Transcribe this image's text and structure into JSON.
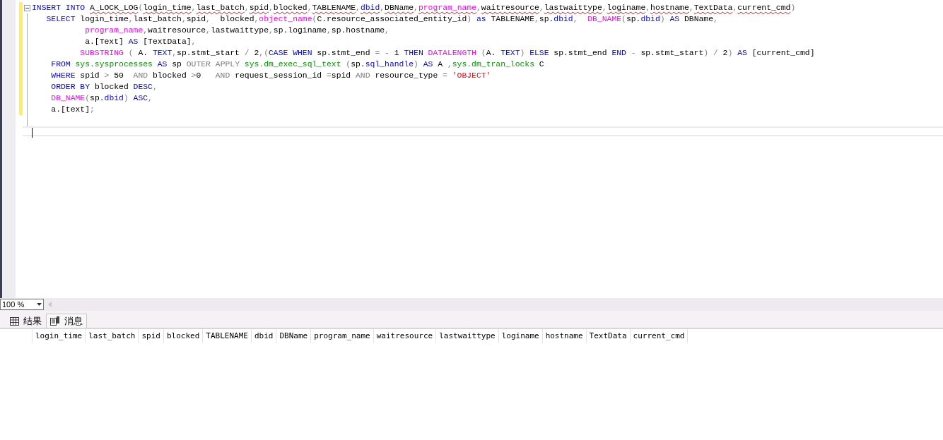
{
  "editor": {
    "lines": [
      {
        "collapsible": true,
        "tokens": [
          {
            "text": "INSERT INTO ",
            "kind": "keyword"
          },
          {
            "text": "A_LOCK_LOG",
            "kind": "plain-flagged"
          },
          {
            "text": "(",
            "kind": "operator"
          },
          {
            "text": "login_time",
            "kind": "plain-flagged"
          },
          {
            "text": ",",
            "kind": "operator"
          },
          {
            "text": "last_batch",
            "kind": "plain-flagged"
          },
          {
            "text": ",",
            "kind": "operator"
          },
          {
            "text": "spid",
            "kind": "plain-flagged"
          },
          {
            "text": ",",
            "kind": "operator"
          },
          {
            "text": "blocked",
            "kind": "plain-flagged"
          },
          {
            "text": ",",
            "kind": "operator"
          },
          {
            "text": "TABLENAME",
            "kind": "plain-flagged"
          },
          {
            "text": ",",
            "kind": "operator"
          },
          {
            "text": "dbid",
            "kind": "keyword-flagged"
          },
          {
            "text": ",",
            "kind": "operator"
          },
          {
            "text": "DBName",
            "kind": "plain-flagged"
          },
          {
            "text": ",",
            "kind": "operator"
          },
          {
            "text": "program_name",
            "kind": "function-flagged"
          },
          {
            "text": ",",
            "kind": "operator"
          },
          {
            "text": "waitresource",
            "kind": "plain-flagged"
          },
          {
            "text": ",",
            "kind": "operator"
          },
          {
            "text": "lastwaittype",
            "kind": "plain-flagged"
          },
          {
            "text": ",",
            "kind": "operator"
          },
          {
            "text": "loginame",
            "kind": "plain-flagged"
          },
          {
            "text": ",",
            "kind": "operator"
          },
          {
            "text": "hostname",
            "kind": "plain-flagged"
          },
          {
            "text": ",",
            "kind": "operator"
          },
          {
            "text": "TextData",
            "kind": "plain-flagged"
          },
          {
            "text": ",",
            "kind": "operator"
          },
          {
            "text": "current_cmd",
            "kind": "plain-flagged"
          },
          {
            "text": ")",
            "kind": "operator"
          }
        ]
      },
      {
        "collapsible": false,
        "tokens": [
          {
            "text": "   SELECT ",
            "kind": "keyword"
          },
          {
            "text": "login_time",
            "kind": "plain"
          },
          {
            "text": ",",
            "kind": "operator"
          },
          {
            "text": "last_batch",
            "kind": "plain"
          },
          {
            "text": ",",
            "kind": "operator"
          },
          {
            "text": "spid",
            "kind": "plain"
          },
          {
            "text": ",",
            "kind": "operator"
          },
          {
            "text": "  blocked",
            "kind": "plain"
          },
          {
            "text": ",",
            "kind": "operator"
          },
          {
            "text": "object_name",
            "kind": "function"
          },
          {
            "text": "(",
            "kind": "operator"
          },
          {
            "text": "C.resource_associated_entity_id",
            "kind": "plain"
          },
          {
            "text": ") ",
            "kind": "operator"
          },
          {
            "text": "as ",
            "kind": "keyword"
          },
          {
            "text": "TABLENAME",
            "kind": "plain"
          },
          {
            "text": ",",
            "kind": "operator"
          },
          {
            "text": "sp.",
            "kind": "plain"
          },
          {
            "text": "dbid",
            "kind": "keyword"
          },
          {
            "text": ",  ",
            "kind": "operator"
          },
          {
            "text": "DB_NAME",
            "kind": "function"
          },
          {
            "text": "(",
            "kind": "operator"
          },
          {
            "text": "sp.",
            "kind": "plain"
          },
          {
            "text": "dbid",
            "kind": "keyword"
          },
          {
            "text": ") ",
            "kind": "operator"
          },
          {
            "text": "AS ",
            "kind": "keyword"
          },
          {
            "text": "DBName",
            "kind": "plain"
          },
          {
            "text": ",",
            "kind": "operator"
          }
        ]
      },
      {
        "collapsible": false,
        "tokens": [
          {
            "text": "           program_name",
            "kind": "function"
          },
          {
            "text": ",",
            "kind": "operator"
          },
          {
            "text": "waitresource",
            "kind": "plain"
          },
          {
            "text": ",",
            "kind": "operator"
          },
          {
            "text": "lastwaittype",
            "kind": "plain"
          },
          {
            "text": ",",
            "kind": "operator"
          },
          {
            "text": "sp.loginame",
            "kind": "plain"
          },
          {
            "text": ",",
            "kind": "operator"
          },
          {
            "text": "sp.hostname",
            "kind": "plain"
          },
          {
            "text": ",",
            "kind": "operator"
          }
        ]
      },
      {
        "collapsible": false,
        "tokens": [
          {
            "text": "           a.[Text] ",
            "kind": "plain"
          },
          {
            "text": "AS ",
            "kind": "keyword"
          },
          {
            "text": "[TextData]",
            "kind": "plain"
          },
          {
            "text": ",",
            "kind": "operator"
          }
        ]
      },
      {
        "collapsible": false,
        "tokens": [
          {
            "text": "          SUBSTRING ",
            "kind": "function"
          },
          {
            "text": "( ",
            "kind": "operator"
          },
          {
            "text": "A. ",
            "kind": "plain"
          },
          {
            "text": "TEXT",
            "kind": "keyword"
          },
          {
            "text": ",",
            "kind": "operator"
          },
          {
            "text": "sp.stmt_start ",
            "kind": "plain"
          },
          {
            "text": "/ ",
            "kind": "operator"
          },
          {
            "text": "2",
            "kind": "plain"
          },
          {
            "text": ",(",
            "kind": "operator"
          },
          {
            "text": "CASE WHEN ",
            "kind": "keyword"
          },
          {
            "text": "sp.stmt_end ",
            "kind": "plain"
          },
          {
            "text": "= - ",
            "kind": "operator"
          },
          {
            "text": "1 ",
            "kind": "plain"
          },
          {
            "text": "THEN ",
            "kind": "keyword"
          },
          {
            "text": "DATALENGTH ",
            "kind": "function"
          },
          {
            "text": "(",
            "kind": "operator"
          },
          {
            "text": "A. ",
            "kind": "plain"
          },
          {
            "text": "TEXT",
            "kind": "keyword"
          },
          {
            "text": ") ",
            "kind": "operator"
          },
          {
            "text": "ELSE ",
            "kind": "keyword"
          },
          {
            "text": "sp.stmt_end ",
            "kind": "plain"
          },
          {
            "text": "END ",
            "kind": "keyword"
          },
          {
            "text": "- ",
            "kind": "operator"
          },
          {
            "text": "sp.stmt_start",
            "kind": "plain"
          },
          {
            "text": ") / ",
            "kind": "operator"
          },
          {
            "text": "2",
            "kind": "plain"
          },
          {
            "text": ") ",
            "kind": "operator"
          },
          {
            "text": "AS ",
            "kind": "keyword"
          },
          {
            "text": "[current_cmd]",
            "kind": "plain"
          }
        ]
      },
      {
        "collapsible": false,
        "tokens": [
          {
            "text": "    FROM ",
            "kind": "keyword"
          },
          {
            "text": "sys.sysprocesses ",
            "kind": "system"
          },
          {
            "text": "AS ",
            "kind": "keyword"
          },
          {
            "text": "sp ",
            "kind": "plain"
          },
          {
            "text": "OUTER APPLY ",
            "kind": "operator"
          },
          {
            "text": "sys.dm_exec_sql_text ",
            "kind": "system"
          },
          {
            "text": "(",
            "kind": "operator"
          },
          {
            "text": "sp.",
            "kind": "plain"
          },
          {
            "text": "sql_handle",
            "kind": "keyword"
          },
          {
            "text": ") ",
            "kind": "operator"
          },
          {
            "text": "AS ",
            "kind": "keyword"
          },
          {
            "text": "A ",
            "kind": "plain"
          },
          {
            "text": ",",
            "kind": "operator"
          },
          {
            "text": "sys.dm_tran_locks ",
            "kind": "system"
          },
          {
            "text": "C",
            "kind": "plain"
          }
        ]
      },
      {
        "collapsible": false,
        "tokens": [
          {
            "text": "    WHERE ",
            "kind": "keyword"
          },
          {
            "text": "spid ",
            "kind": "plain"
          },
          {
            "text": "> ",
            "kind": "operator"
          },
          {
            "text": "50  ",
            "kind": "plain"
          },
          {
            "text": "AND ",
            "kind": "operator"
          },
          {
            "text": "blocked ",
            "kind": "plain"
          },
          {
            "text": ">",
            "kind": "operator"
          },
          {
            "text": "0   ",
            "kind": "plain"
          },
          {
            "text": "AND ",
            "kind": "operator"
          },
          {
            "text": "request_session_id ",
            "kind": "plain"
          },
          {
            "text": "=",
            "kind": "operator"
          },
          {
            "text": "spid ",
            "kind": "plain"
          },
          {
            "text": "AND ",
            "kind": "operator"
          },
          {
            "text": "resource_type ",
            "kind": "plain"
          },
          {
            "text": "= ",
            "kind": "operator"
          },
          {
            "text": "'OBJECT'",
            "kind": "string"
          }
        ]
      },
      {
        "collapsible": false,
        "tokens": [
          {
            "text": "    ORDER BY ",
            "kind": "keyword"
          },
          {
            "text": "blocked ",
            "kind": "plain"
          },
          {
            "text": "DESC",
            "kind": "keyword"
          },
          {
            "text": ",",
            "kind": "operator"
          }
        ]
      },
      {
        "collapsible": false,
        "tokens": [
          {
            "text": "    DB_NAME",
            "kind": "function"
          },
          {
            "text": "(",
            "kind": "operator"
          },
          {
            "text": "sp.",
            "kind": "plain"
          },
          {
            "text": "dbid",
            "kind": "keyword"
          },
          {
            "text": ") ",
            "kind": "operator"
          },
          {
            "text": "ASC",
            "kind": "keyword"
          },
          {
            "text": ",",
            "kind": "operator"
          }
        ]
      },
      {
        "collapsible": false,
        "tokens": [
          {
            "text": "    a.[text]",
            "kind": "plain"
          },
          {
            "text": ";",
            "kind": "operator"
          }
        ]
      }
    ]
  },
  "zoom": {
    "value": "100 %"
  },
  "tabs": [
    {
      "label": "结果",
      "selected": true,
      "kind": "grid"
    },
    {
      "label": "消息",
      "selected": false,
      "kind": "messages"
    }
  ],
  "grid": {
    "columns": [
      "login_time",
      "last_batch",
      "spid",
      "blocked",
      "TABLENAME",
      "dbid",
      "DBName",
      "program_name",
      "waitresource",
      "lastwaittype",
      "loginame",
      "hostname",
      "TextData",
      "current_cmd"
    ]
  }
}
